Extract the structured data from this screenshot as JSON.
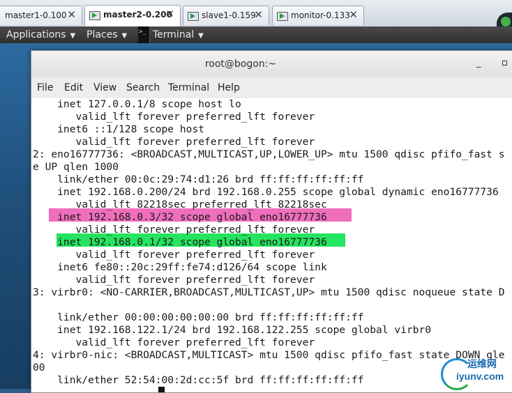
{
  "vm_tabs": [
    {
      "name": "master1-0.100",
      "close": "✕"
    },
    {
      "name": "master2-0.200",
      "close": "✕"
    },
    {
      "name": "slave1-0.159",
      "close": "✕"
    },
    {
      "name": "monitor-0.133",
      "close": "✕"
    }
  ],
  "topbar": {
    "applications": "Applications",
    "places": "Places",
    "terminal": "Terminal",
    "caret": "▼"
  },
  "window": {
    "title": "root@bogon:~",
    "minimize": "_"
  },
  "menubar": [
    "File",
    "Edit",
    "View",
    "Search",
    "Terminal",
    "Help"
  ],
  "terminal_lines": [
    "    inet 127.0.0.1/8 scope host lo",
    "       valid_lft forever preferred_lft forever",
    "    inet6 ::1/128 scope host",
    "       valid_lft forever preferred_lft forever",
    "2: eno16777736: <BROADCAST,MULTICAST,UP,LOWER_UP> mtu 1500 qdisc pfifo_fast s",
    "e UP qlen 1000",
    "    link/ether 00:0c:29:74:d1:26 brd ff:ff:ff:ff:ff:ff",
    "    inet 192.168.0.200/24 brd 192.168.0.255 scope global dynamic eno16777736",
    "       valid_lft 82218sec preferred_lft 82218sec",
    "    inet 192.168.0.3/32 scope global eno16777736",
    "       valid_lft forever preferred_lft forever",
    "    inet 192.168.0.1/32 scope global eno16777736",
    "       valid_lft forever preferred_lft forever",
    "    inet6 fe80::20c:29ff:fe74:d126/64 scope link",
    "       valid_lft forever preferred_lft forever",
    "3: virbr0: <NO-CARRIER,BROADCAST,MULTICAST,UP> mtu 1500 qdisc noqueue state D",
    "",
    "    link/ether 00:00:00:00:00:00 brd ff:ff:ff:ff:ff:ff",
    "    inet 192.168.122.1/24 brd 192.168.122.255 scope global virbr0",
    "       valid_lft forever preferred_lft forever",
    "4: virbr0-nic: <BROADCAST,MULTICAST> mtu 1500 qdisc pfifo_fast state DOWN qle",
    "00",
    "    link/ether 52:54:00:2d:cc:5f brd ff:ff:ff:ff:ff:ff"
  ],
  "highlight_colors": {
    "pink": "#ef6fbc",
    "green": "#25e45f"
  },
  "watermark": {
    "top": "运维网",
    "bottom": "iyunv.com"
  }
}
